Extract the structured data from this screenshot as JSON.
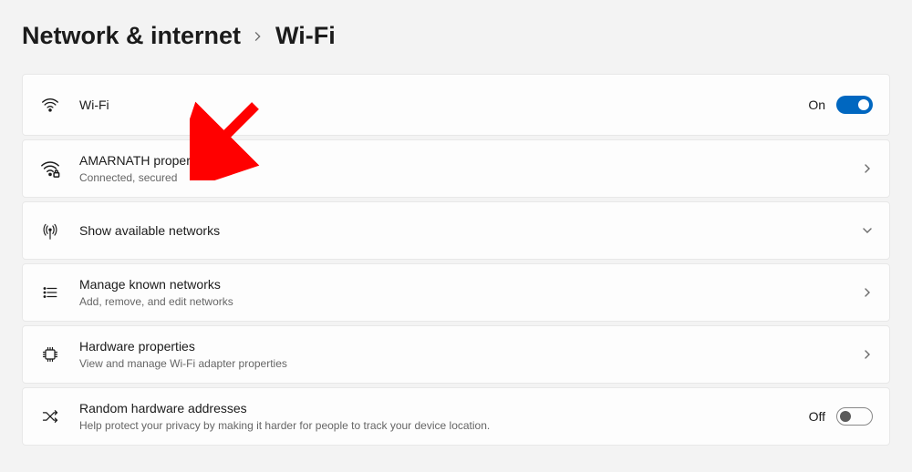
{
  "breadcrumb": {
    "parent": "Network & internet",
    "current": "Wi-Fi"
  },
  "wifi_card": {
    "title": "Wi-Fi",
    "state_label": "On"
  },
  "network_card": {
    "title": "AMARNATH properties",
    "subtitle": "Connected, secured"
  },
  "available_card": {
    "title": "Show available networks"
  },
  "manage_card": {
    "title": "Manage known networks",
    "subtitle": "Add, remove, and edit networks"
  },
  "hardware_card": {
    "title": "Hardware properties",
    "subtitle": "View and manage Wi-Fi adapter properties"
  },
  "random_card": {
    "title": "Random hardware addresses",
    "subtitle": "Help protect your privacy by making it harder for people to track your device location.",
    "state_label": "Off"
  }
}
